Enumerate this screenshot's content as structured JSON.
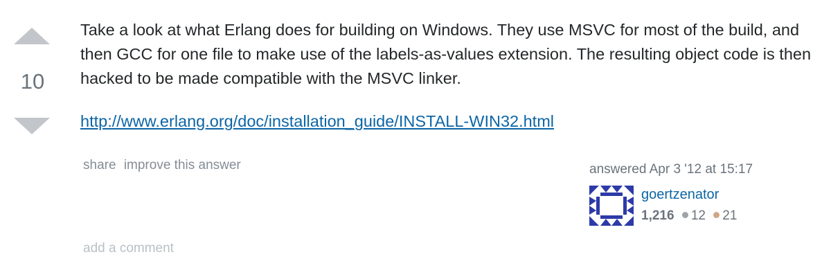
{
  "vote": {
    "count": "10"
  },
  "post": {
    "paragraph": "Take a look at what Erlang does for building on Windows. They use MSVC for most of the build, and then GCC for one file to make use of the labels-as-values extension. The resulting object code is then hacked to be made compatible with the MSVC linker.",
    "link_text": "http://www.erlang.org/doc/installation_guide/INSTALL-WIN32.html"
  },
  "menu": {
    "share_label": "share",
    "improve_label": "improve this answer"
  },
  "signature": {
    "action": "answered Apr 3 '12 at 15:17",
    "user_name": "goertzenator",
    "reputation": "1,216",
    "silver_badges": "12",
    "bronze_badges": "21",
    "avatar_icon": "identicon-avatar"
  },
  "comments": {
    "add_label": "add a comment"
  },
  "colors": {
    "link": "#0c65a5",
    "vote_arrow": "#c2c6ca",
    "silver_badge": "#9ea3a8",
    "bronze_badge": "#d1a684",
    "avatar": "#2d3aa8"
  }
}
